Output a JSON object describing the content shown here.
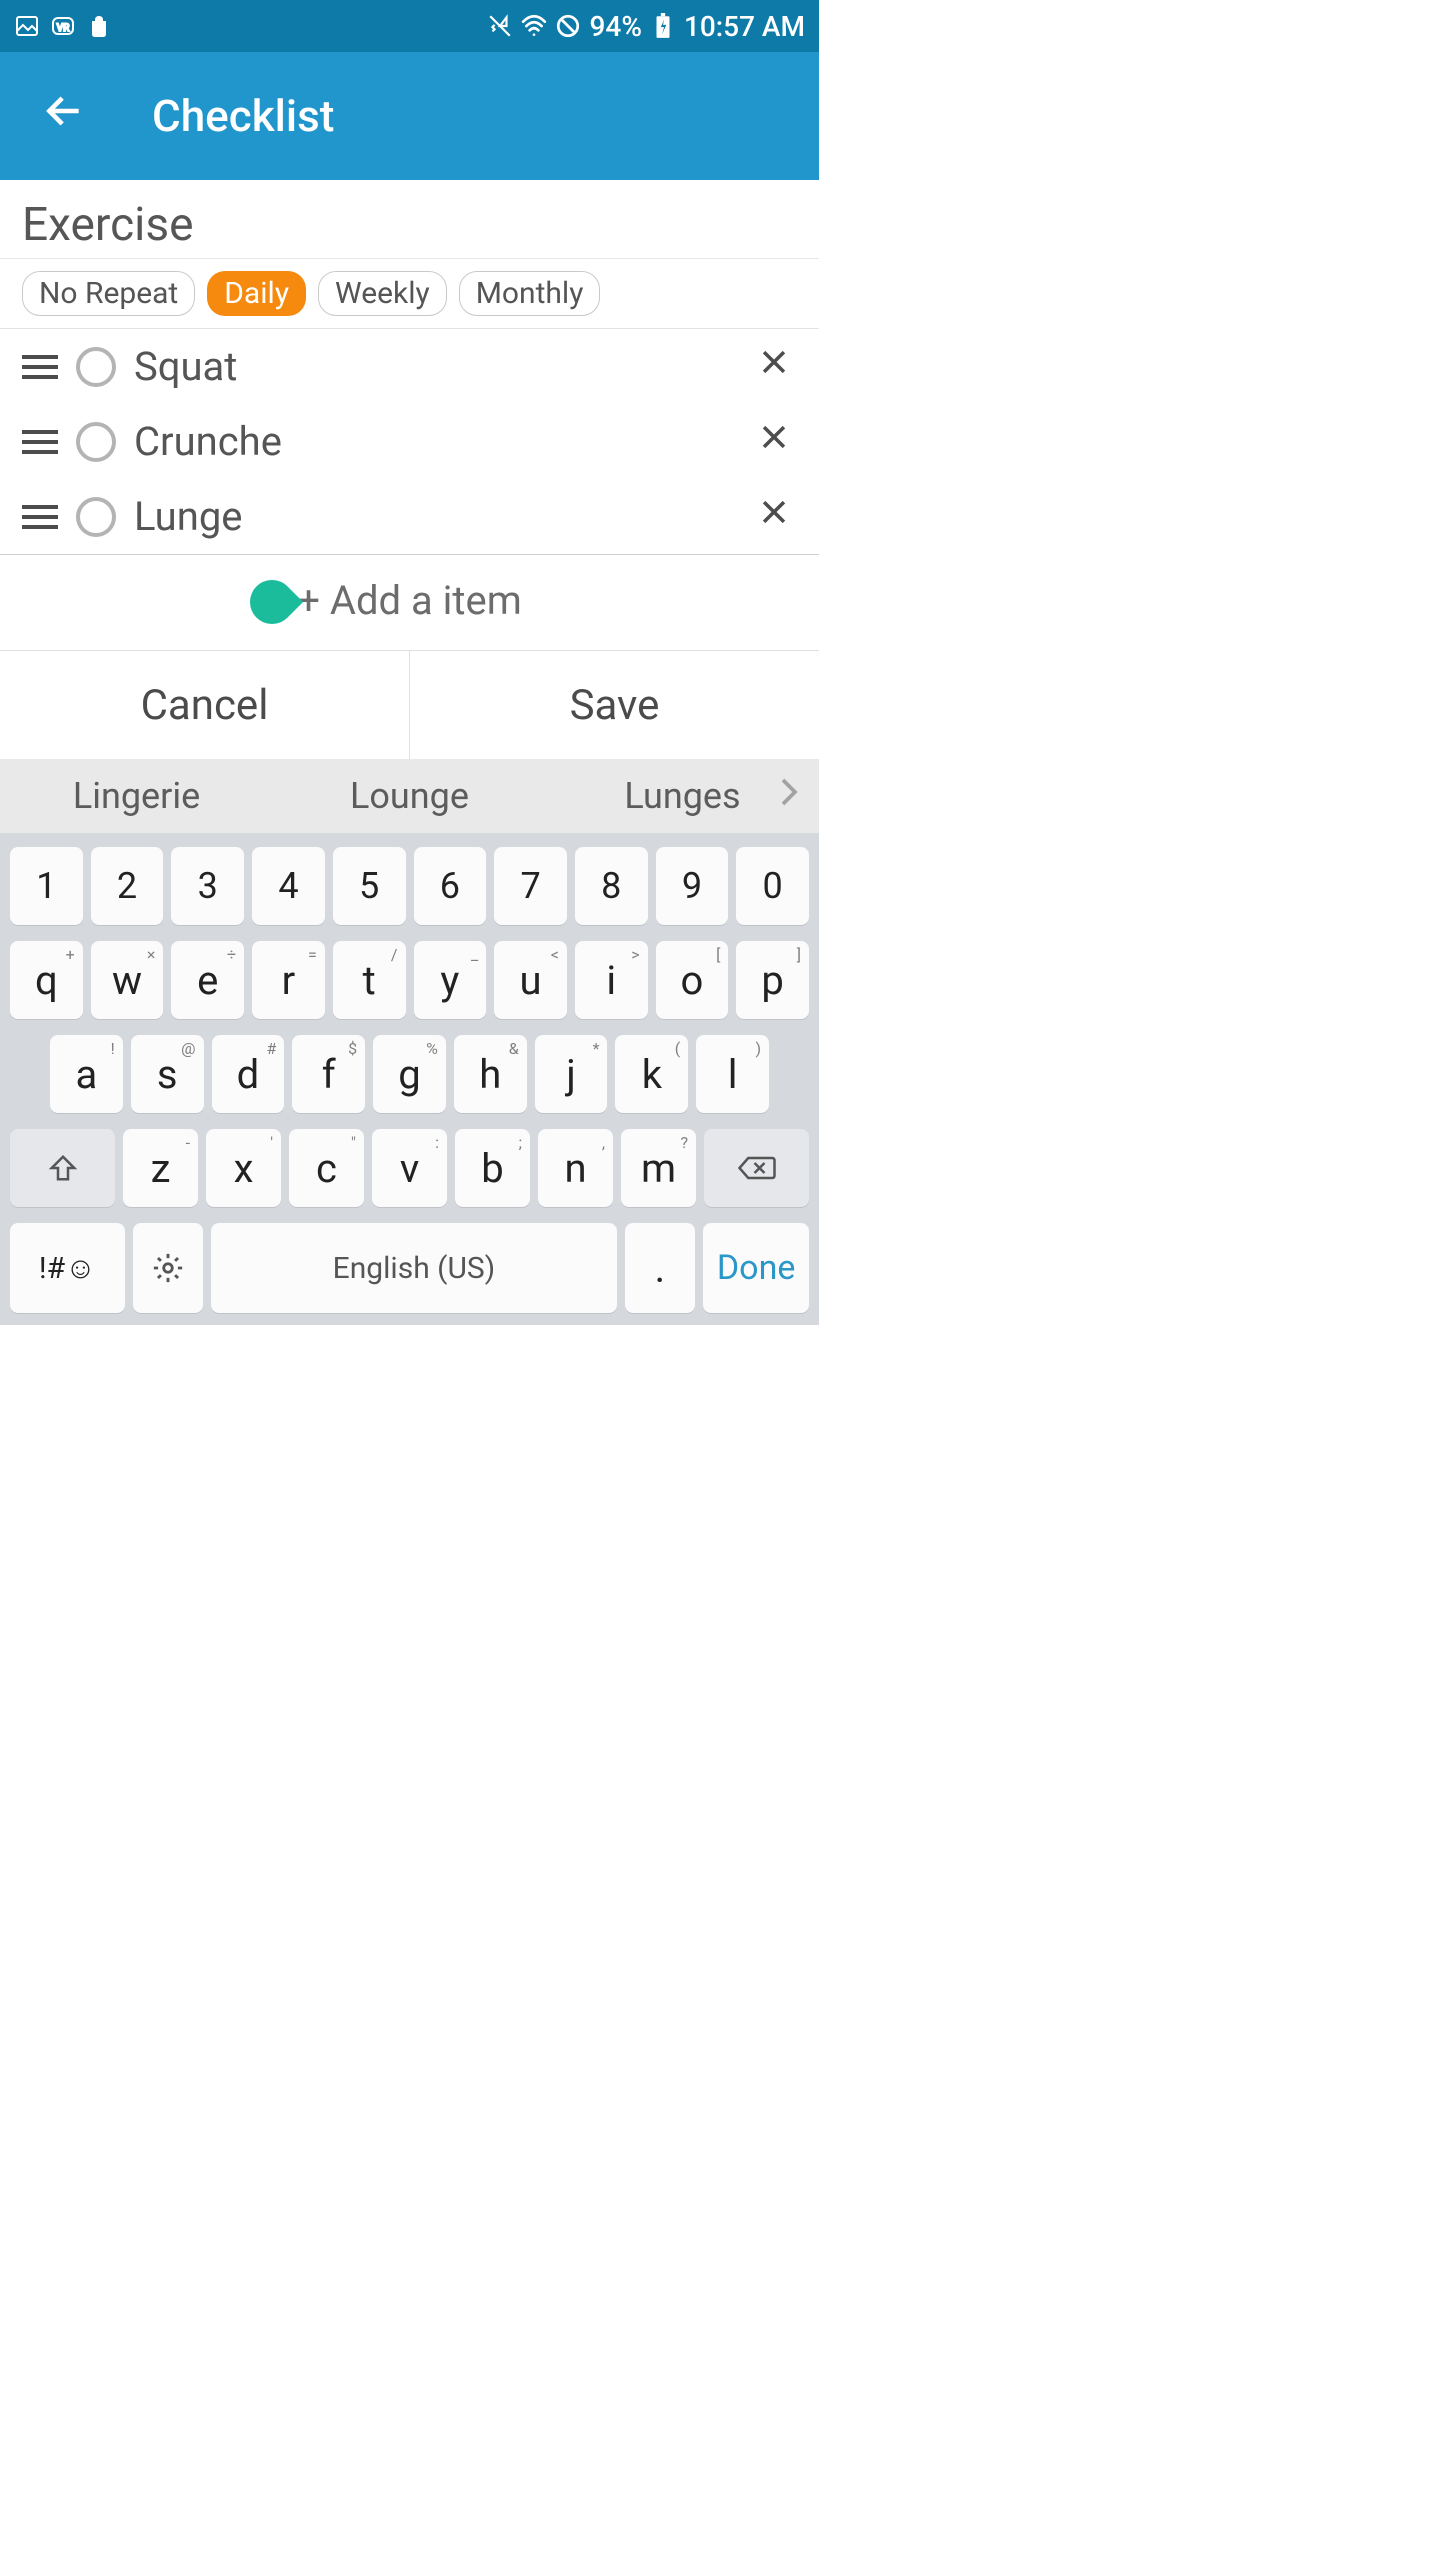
{
  "status": {
    "battery": "94%",
    "time": "10:57 AM"
  },
  "appbar": {
    "title": "Checklist"
  },
  "checklist": {
    "title": "Exercise",
    "repeat": [
      "No Repeat",
      "Daily",
      "Weekly",
      "Monthly"
    ],
    "active_repeat": 1,
    "items": [
      {
        "label": "Squat"
      },
      {
        "label": "Crunche"
      },
      {
        "label": "Lunge"
      }
    ],
    "add_label": "+ Add a item"
  },
  "actions": {
    "cancel": "Cancel",
    "save": "Save"
  },
  "keyboard": {
    "suggestions": [
      "Lingerie",
      "Lounge",
      "Lunges"
    ],
    "numbers": [
      "1",
      "2",
      "3",
      "4",
      "5",
      "6",
      "7",
      "8",
      "9",
      "0"
    ],
    "row2": [
      {
        "k": "q",
        "a": "+"
      },
      {
        "k": "w",
        "a": "×"
      },
      {
        "k": "e",
        "a": "÷"
      },
      {
        "k": "r",
        "a": "="
      },
      {
        "k": "t",
        "a": "/"
      },
      {
        "k": "y",
        "a": "_"
      },
      {
        "k": "u",
        "a": "<"
      },
      {
        "k": "i",
        "a": ">"
      },
      {
        "k": "o",
        "a": "["
      },
      {
        "k": "p",
        "a": "]"
      }
    ],
    "row3": [
      {
        "k": "a",
        "a": "!"
      },
      {
        "k": "s",
        "a": "@"
      },
      {
        "k": "d",
        "a": "#"
      },
      {
        "k": "f",
        "a": "$"
      },
      {
        "k": "g",
        "a": "%"
      },
      {
        "k": "h",
        "a": "&"
      },
      {
        "k": "j",
        "a": "*"
      },
      {
        "k": "k",
        "a": "("
      },
      {
        "k": "l",
        "a": ")"
      }
    ],
    "row4": [
      {
        "k": "z",
        "a": "-"
      },
      {
        "k": "x",
        "a": "'"
      },
      {
        "k": "c",
        "a": "\""
      },
      {
        "k": "v",
        "a": ":"
      },
      {
        "k": "b",
        "a": ";"
      },
      {
        "k": "n",
        "a": ","
      },
      {
        "k": "m",
        "a": "?"
      }
    ],
    "sym": "!#☺",
    "space": "English (US)",
    "period": ".",
    "done": "Done"
  }
}
